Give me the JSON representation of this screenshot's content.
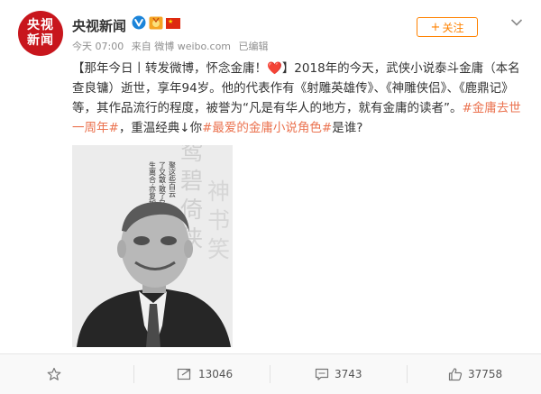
{
  "author": {
    "avatar_line1": "央视",
    "avatar_line2": "新闻",
    "name": "央视新闻",
    "flag_star": "★"
  },
  "meta": {
    "time": "今天 07:00",
    "source": "来自 微博 weibo.com",
    "edited": "已编辑"
  },
  "follow": {
    "plus": "+",
    "label": "关注"
  },
  "post": {
    "part1": "【那年今日丨转发微博，怀念金庸！",
    "heart": "❤️",
    "part2": "】2018年的今天，武侠小说泰斗金庸（本名查良镛）逝世，享年94岁。他的代表作有",
    "book1": "《射雕英雄传》",
    "sep1": "、",
    "book2": "《神雕侠侣》",
    "sep2": "、",
    "book3": "《鹿鼎记》",
    "part3": "等，其作品流行的程度，被誉为“凡是有华人的地方，就有金庸的读者”。",
    "tag1": "#金庸去世一周年#",
    "part4": "，重温经典↓你",
    "tag2": "#最爱的金庸小说角色#",
    "part5": "是谁?"
  },
  "photo": {
    "calligraphy": [
      "笑",
      "书",
      "神",
      "侠",
      "倚",
      "碧",
      "鸳"
    ],
    "poem_col1": "聚这些白云",
    "poem_col2": "了又散·散了又聚·",
    "poem_col3": "生离合·亦复如斯·"
  },
  "toolbar": {
    "repost_count": "13046",
    "comment_count": "3743",
    "like_count": "37758"
  },
  "colors": {
    "brand_red": "#c8161d",
    "accent_orange": "#ff8200",
    "link": "#eb7350",
    "heart": "#e8303a"
  }
}
